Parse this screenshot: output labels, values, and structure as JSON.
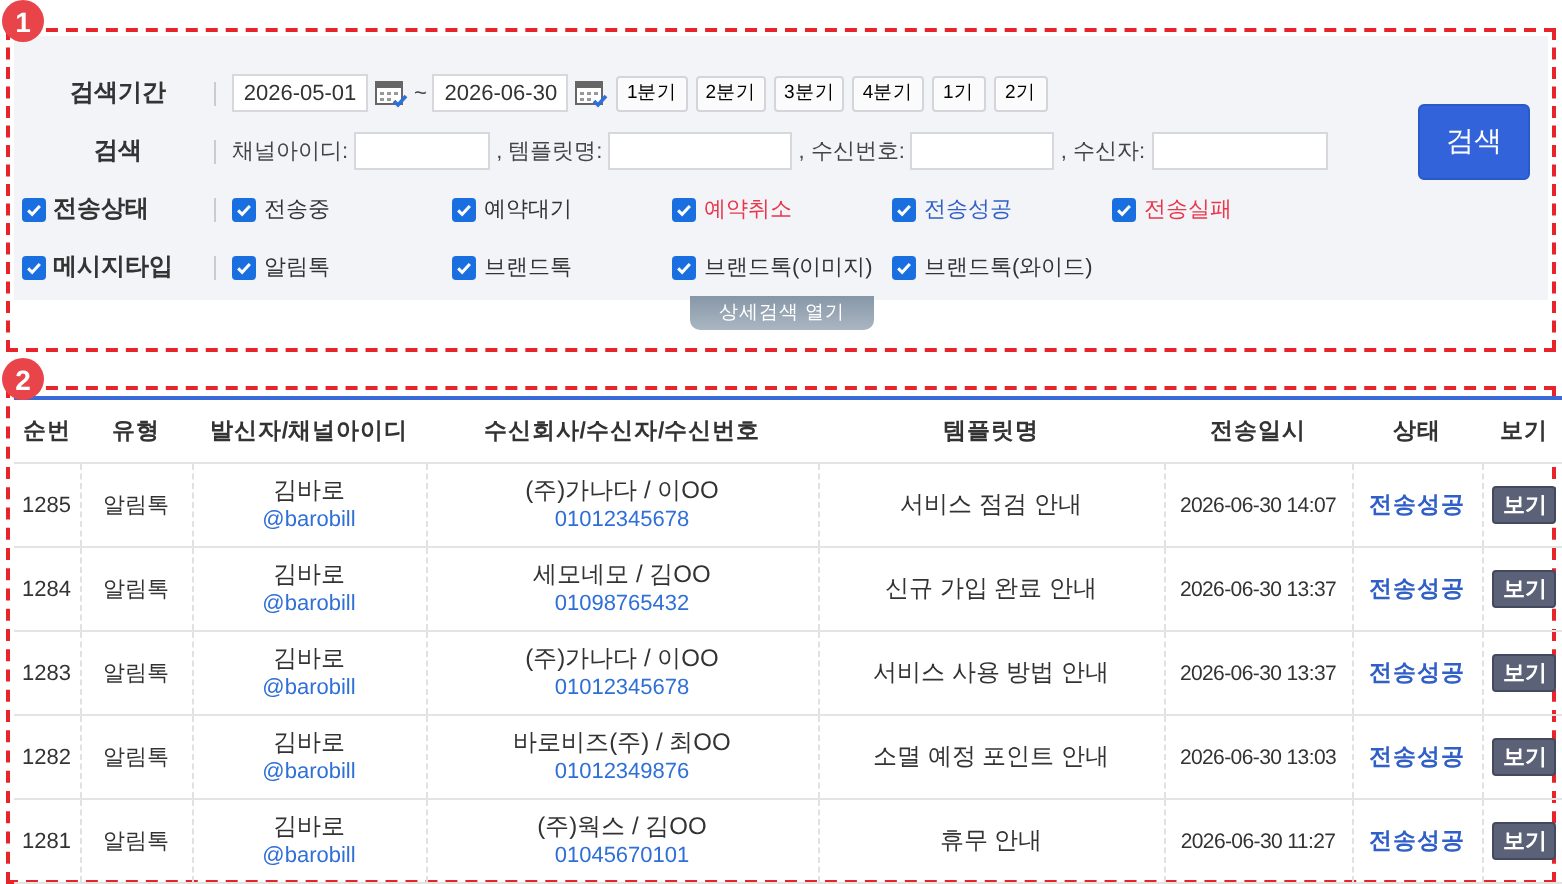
{
  "search_panel": {
    "badge": "1",
    "period": {
      "label": "검색기간",
      "from": "2026-05-01",
      "separator": "~",
      "to": "2026-06-30",
      "presets": [
        "1분기",
        "2분기",
        "3분기",
        "4분기",
        "1기",
        "2기"
      ]
    },
    "search": {
      "label": "검색",
      "fields": [
        {
          "label": "채널아이디:"
        },
        {
          "label": ", 템플릿명:"
        },
        {
          "label": ", 수신번호:"
        },
        {
          "label": ", 수신자:"
        }
      ],
      "button": "검색"
    },
    "filters": [
      {
        "label": "전송상태",
        "checked": true,
        "options": [
          {
            "label": "전송중",
            "checked": true,
            "color": "#333333"
          },
          {
            "label": "예약대기",
            "checked": true,
            "color": "#333333"
          },
          {
            "label": "예약취소",
            "checked": true,
            "color": "#e8364a"
          },
          {
            "label": "전송성공",
            "checked": true,
            "color": "#2f5fc7"
          },
          {
            "label": "전송실패",
            "checked": true,
            "color": "#e8364a"
          }
        ]
      },
      {
        "label": "메시지타입",
        "checked": true,
        "options": [
          {
            "label": "알림톡",
            "checked": true,
            "color": "#333333"
          },
          {
            "label": "브랜드톡",
            "checked": true,
            "color": "#333333"
          },
          {
            "label": "브랜드톡(이미지)",
            "checked": true,
            "color": "#333333"
          },
          {
            "label": "브랜드톡(와이드)",
            "checked": true,
            "color": "#333333"
          }
        ]
      }
    ],
    "toggle": "상세검색 열기"
  },
  "results": {
    "badge": "2",
    "columns": [
      "순번",
      "유형",
      "발신자/채널아이디",
      "수신회사/수신자/수신번호",
      "템플릿명",
      "전송일시",
      "상태",
      "보기"
    ],
    "rows": [
      {
        "no": "1285",
        "type": "알림톡",
        "sender": "김바로",
        "channel": "@barobill",
        "recipient": "(주)가나다 / 이OO",
        "phone": "01012345678",
        "template": "서비스 점검 안내",
        "sent_at": "2026-06-30 14:07",
        "status": "전송성공",
        "action": "보기"
      },
      {
        "no": "1284",
        "type": "알림톡",
        "sender": "김바로",
        "channel": "@barobill",
        "recipient": "세모네모 / 김OO",
        "phone": "01098765432",
        "template": "신규 가입 완료 안내",
        "sent_at": "2026-06-30 13:37",
        "status": "전송성공",
        "action": "보기"
      },
      {
        "no": "1283",
        "type": "알림톡",
        "sender": "김바로",
        "channel": "@barobill",
        "recipient": "(주)가나다 / 이OO",
        "phone": "01012345678",
        "template": "서비스 사용 방법 안내",
        "sent_at": "2026-06-30 13:37",
        "status": "전송성공",
        "action": "보기"
      },
      {
        "no": "1282",
        "type": "알림톡",
        "sender": "김바로",
        "channel": "@barobill",
        "recipient": "바로비즈(주) / 최OO",
        "phone": "01012349876",
        "template": "소멸 예정 포인트 안내",
        "sent_at": "2026-06-30 13:03",
        "status": "전송성공",
        "action": "보기"
      },
      {
        "no": "1281",
        "type": "알림톡",
        "sender": "김바로",
        "channel": "@barobill",
        "recipient": "(주)웍스 / 김OO",
        "phone": "01045670101",
        "template": "휴무 안내",
        "sent_at": "2026-06-30 11:27",
        "status": "전송성공",
        "action": "보기"
      }
    ]
  }
}
